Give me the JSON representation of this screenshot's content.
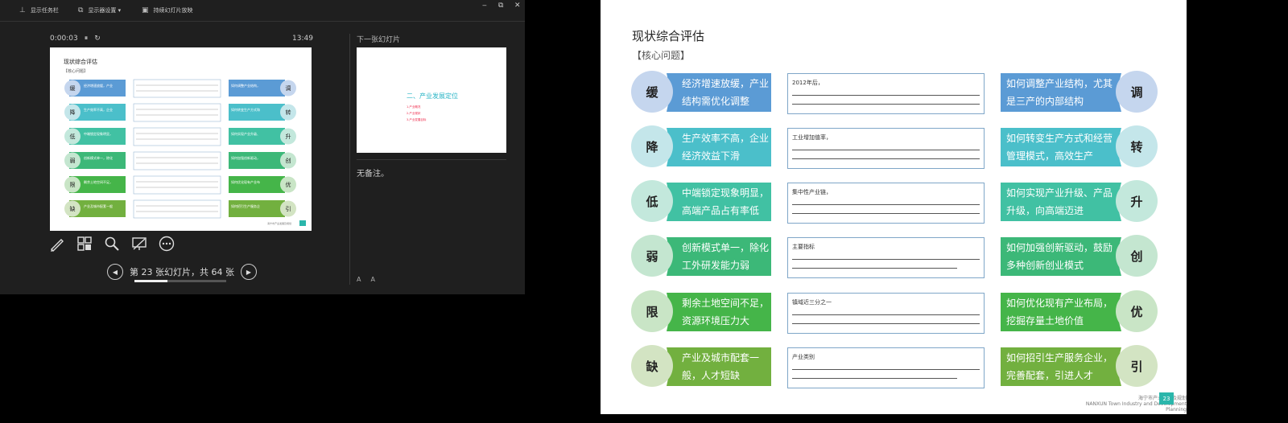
{
  "toolbar": {
    "show_taskbar": "显示任务栏",
    "display_settings": "显示器设置 ▾",
    "swap_displays": "持续幻灯片放映"
  },
  "window_controls": {
    "minimize": "‒",
    "restore": "⧉",
    "close": "✕"
  },
  "presenter": {
    "elapsed": "0:00:03",
    "pause_glyph": "⏸",
    "restart_glyph": "↻",
    "clock": "13:49",
    "next_label": "下一张幻灯片",
    "notes": "无备注。",
    "font_buttons": [
      "A",
      "A"
    ],
    "slide_counter": "第 23 张幻灯片，共 64 张",
    "progress_fraction": 0.36,
    "tools": [
      "pen-icon",
      "slides-grid-icon",
      "zoom-icon",
      "black-screen-icon",
      "more-icon"
    ]
  },
  "next_slide": {
    "title": "二、产业发展定位",
    "items": [
      "1.产业概况",
      "2.产业现状",
      "3.产业发展目标"
    ]
  },
  "slide": {
    "title": "现状综合评估",
    "subtitle": "【核心问题】",
    "rows": [
      {
        "left_char": "缓",
        "left_text": "经济增速放缓，产业结构需优化调整",
        "mid_text": "2012年后，",
        "right_text": "如何调整产业结构，尤其是三产的内部结构",
        "right_char": "调",
        "left_color": "#5b9bd5",
        "right_color": "#5b9bd5",
        "circle_color": "#c5d6ee"
      },
      {
        "left_char": "降",
        "left_text": "生产效率不高，企业经济效益下滑",
        "mid_text": "工业增加值率，",
        "right_text": "如何转变生产方式和经营管理模式，高效生产",
        "right_char": "转",
        "left_color": "#4bbfca",
        "right_color": "#4bbfca",
        "circle_color": "#c4e6ea"
      },
      {
        "left_char": "低",
        "left_text": "中端锁定现象明显，高端产品占有率低",
        "mid_text": "集中性产业链，",
        "right_text": "如何实现产业升级、产品升级，向高端迈进",
        "right_char": "升",
        "left_color": "#41c1a3",
        "right_color": "#41c1a3",
        "circle_color": "#c3e8dc"
      },
      {
        "left_char": "弱",
        "left_text": "创新模式单一，除化工外研发能力弱",
        "mid_text": "主要指标",
        "right_text": "如何加强创新驱动，鼓励多种创新创业模式",
        "right_char": "创",
        "left_color": "#3cb878",
        "right_color": "#3cb878",
        "circle_color": "#c4e6d0"
      },
      {
        "left_char": "限",
        "left_text": "剩余土地空间不足，资源环境压力大",
        "mid_text": "镇域近三分之一",
        "right_text": "如何优化现有产业布局，挖掘存量土地价值",
        "right_char": "优",
        "left_color": "#45b549",
        "right_color": "#45b549",
        "circle_color": "#c9e5c6"
      },
      {
        "left_char": "缺",
        "left_text": "产业及城市配套一般，人才短缺",
        "mid_text": "产业类别",
        "right_text": "如何招引生产服务企业，完善配套，引进人才",
        "right_char": "引",
        "left_color": "#72b03f",
        "right_color": "#72b03f",
        "circle_color": "#d3e4c3"
      }
    ],
    "footer_line1": "海宁市产业发展及规划",
    "footer_line2": "NANXUN Town Industry and Development Planning",
    "page_number": "23"
  }
}
